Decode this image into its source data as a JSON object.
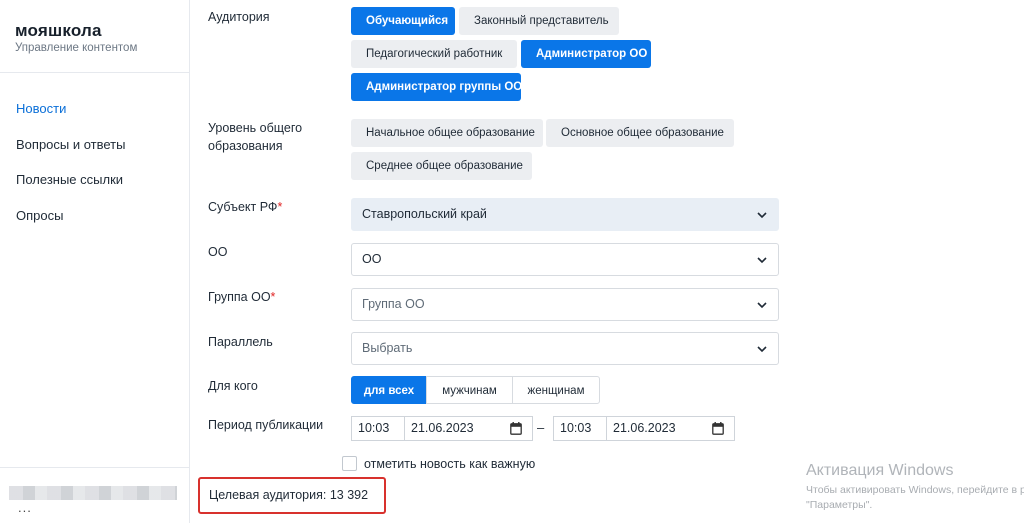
{
  "sidebar": {
    "logo_title": "мояшкола",
    "logo_subtitle": "Управление контентом",
    "items": [
      {
        "label": "Новости",
        "active": true
      },
      {
        "label": "Вопросы и ответы"
      },
      {
        "label": "Полезные ссылки"
      },
      {
        "label": "Опросы"
      }
    ],
    "user_more": "..."
  },
  "form": {
    "audience": {
      "label": "Аудитория",
      "options": [
        {
          "label": "Обучающийся",
          "selected": true
        },
        {
          "label": "Законный представитель",
          "selected": false
        },
        {
          "label": "Педагогический работник",
          "selected": false
        },
        {
          "label": "Администратор ОО",
          "selected": true
        },
        {
          "label": "Администратор группы ОО",
          "selected": true
        }
      ]
    },
    "education_level": {
      "label_line1": "Уровень общего",
      "label_line2": "образования",
      "options": [
        {
          "label": "Начальное общее образование"
        },
        {
          "label": "Основное общее образование"
        },
        {
          "label": "Среднее общее образование"
        }
      ]
    },
    "region": {
      "label": "Субъект РФ",
      "required_mark": "*",
      "value": "Ставропольский край"
    },
    "org": {
      "label": "ОО",
      "value": "ОО"
    },
    "org_group": {
      "label": "Группа ОО",
      "required_mark": "*",
      "placeholder": "Группа ОО"
    },
    "grade": {
      "label": "Параллель",
      "placeholder": "Выбрать"
    },
    "for_whom": {
      "label": "Для кого",
      "options": [
        {
          "label": "для всех",
          "selected": true
        },
        {
          "label": "мужчинам"
        },
        {
          "label": "женщинам"
        }
      ]
    },
    "period": {
      "label": "Период публикации",
      "start_time": "10:03",
      "start_date": "21.06.2023",
      "separator": "–",
      "end_time": "10:03",
      "end_date": "21.06.2023"
    },
    "important": {
      "label": "отметить новость как важную",
      "checked": false
    },
    "target_audience": "Целевая аудитория: 13 392"
  },
  "watermark": {
    "title": "Активация Windows",
    "line1": "Чтобы активировать Windows, перейдите в р",
    "line2": "\"Параметры\"."
  },
  "colors": {
    "accent": "#0a76e8",
    "active_nav": "#0a6fd8",
    "highlight_border": "#d8312d"
  },
  "icons": {
    "select_arrow": "chevron-down-icon",
    "date_picker": "calendar-icon"
  }
}
